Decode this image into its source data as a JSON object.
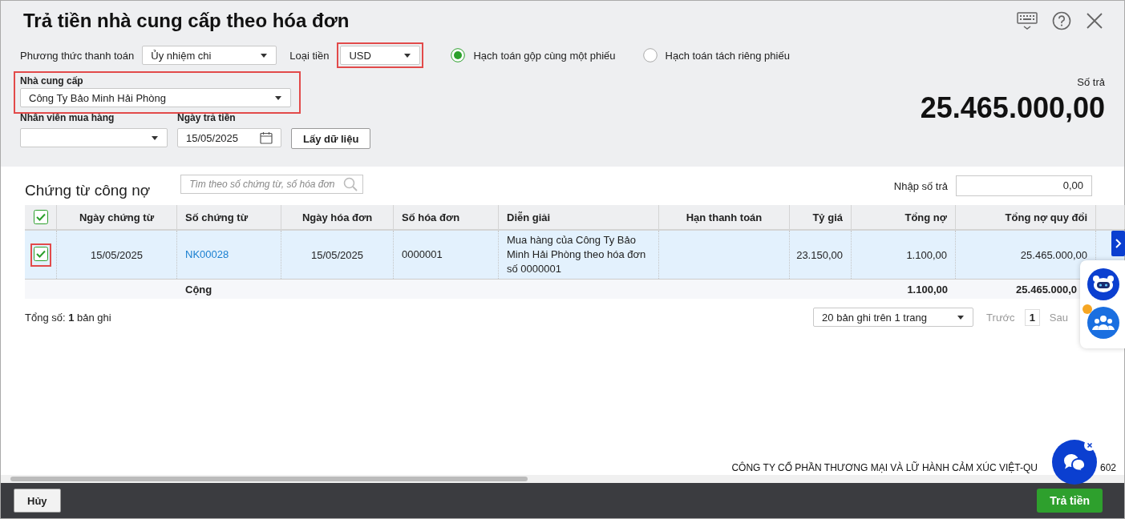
{
  "window": {
    "title": "Trả tiền nhà cung cấp theo hóa đơn"
  },
  "payment_method": {
    "label": "Phương thức thanh toán",
    "value": "Ủy nhiệm chi"
  },
  "currency": {
    "label": "Loại tiền",
    "value": "USD",
    "highlighted": true
  },
  "posting_options": [
    {
      "label": "Hạch toán gộp cùng một phiếu",
      "selected": true
    },
    {
      "label": "Hạch toán tách riêng phiếu",
      "selected": false
    }
  ],
  "supplier": {
    "label": "Nhà cung cấp",
    "value": "Công Ty Bảo Minh Hải Phòng",
    "highlighted": true
  },
  "purchasing_staff": {
    "label": "Nhân viên mua hàng"
  },
  "payment_date": {
    "label": "Ngày trả tiền",
    "value": "15/05/2025"
  },
  "fetch_button": "Lấy dữ liệu",
  "amount": {
    "label": "Số trả",
    "value": "25.465.000,00"
  },
  "documents": {
    "title": "Chứng từ công nợ",
    "search": {
      "placeholder": "Tìm theo số chứng từ, số hóa đơn"
    },
    "amount_input": {
      "label": "Nhập số trả",
      "value": "0,00"
    },
    "all_checked": true,
    "columns": [
      {
        "label": "Ngày chứng từ"
      },
      {
        "label": "Số chứng từ"
      },
      {
        "label": "Ngày hóa đơn"
      },
      {
        "label": "Số hóa đơn"
      },
      {
        "label": "Diễn giải"
      },
      {
        "label": "Hạn thanh toán"
      },
      {
        "label": "Tỷ giá"
      },
      {
        "label": "Tổng nợ"
      },
      {
        "label": "Tổng nợ quy đổi"
      }
    ],
    "rows": [
      {
        "checked": true,
        "highlighted": true,
        "doc_date": "15/05/2025",
        "doc_no": "NK00028",
        "invoice_date": "15/05/2025",
        "invoice_no": "0000001",
        "description": "Mua hàng của Công Ty Bảo Minh Hải Phòng theo hóa đơn số 0000001",
        "exchange_rate": "23.150,00",
        "total_debt": "1.100,00",
        "total_converted": "25.465.000,00"
      }
    ],
    "totals": {
      "label": "Cộng",
      "total_debt": "1.100,00",
      "total_converted": "25.465.000,0"
    }
  },
  "pager": {
    "summary": "Tổng số: **1** bản ghi",
    "page_size": "20 bản ghi trên 1 trang",
    "prev": "Trước",
    "page": "1",
    "next": "Sau"
  },
  "company_name": [
    "CÔNG TY CỔ PHẦN THƯƠNG MẠI VÀ LỮ HÀNH CẢM XÚC VIỆT-QU",
    "602"
  ],
  "buttons": {
    "cancel": "Hủy",
    "pay": "Trả tiền"
  }
}
